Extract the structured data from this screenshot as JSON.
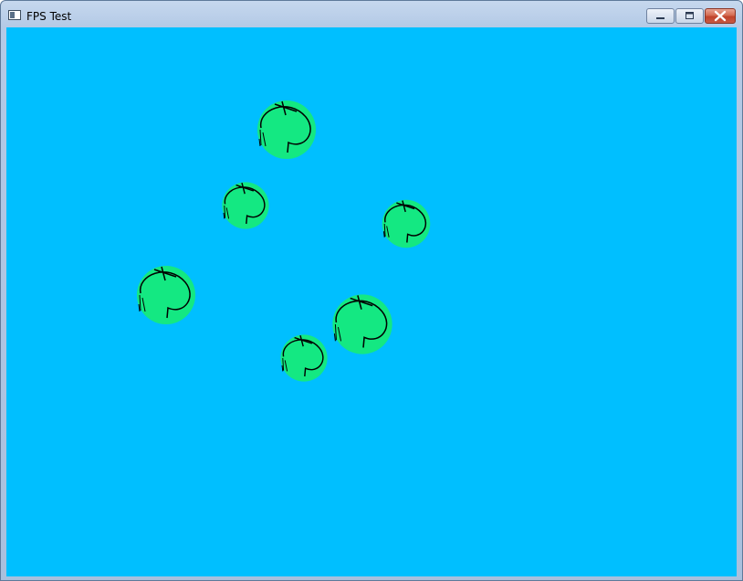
{
  "window": {
    "title": "FPS Test",
    "icon": "application-icon",
    "controls": [
      "minimize-icon",
      "maximize-icon",
      "close-icon"
    ]
  },
  "scene": {
    "background_color": "#00bfff",
    "ball_color": "#14e882",
    "line_color": "#000000",
    "ball_count": 6
  }
}
